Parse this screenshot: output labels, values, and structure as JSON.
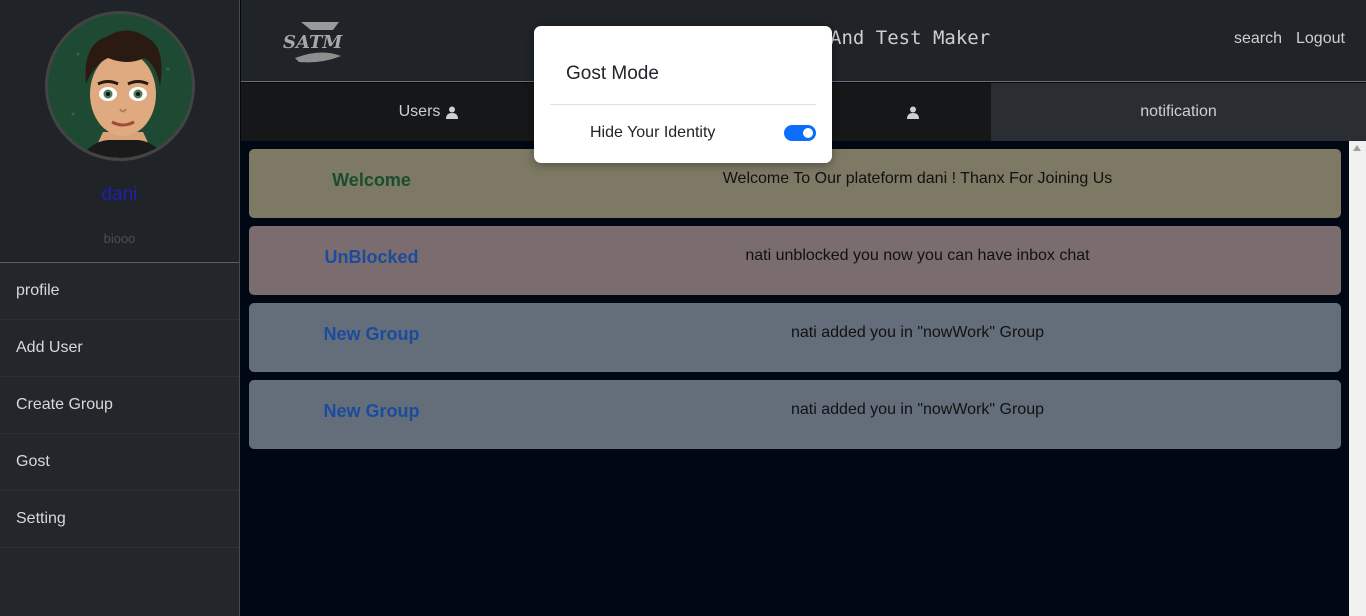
{
  "sidebar": {
    "username": "dani",
    "bio": "biooo",
    "items": [
      {
        "label": "profile"
      },
      {
        "label": "Add User"
      },
      {
        "label": "Create Group"
      },
      {
        "label": "Gost"
      },
      {
        "label": "Setting"
      }
    ]
  },
  "header": {
    "logo_text": "SATM",
    "title": "And Test Maker",
    "search_label": "search",
    "logout_label": "Logout"
  },
  "tabs": [
    {
      "label": "Users",
      "icon": "user-icon"
    },
    {
      "label": "",
      "icon": "user-icon"
    },
    {
      "label": "notification"
    }
  ],
  "notifications": [
    {
      "title": "Welcome",
      "message": "Welcome To Our plateform dani ! Thanx For Joining Us",
      "bg": "#7d7964",
      "title_color": "#1a4d2e"
    },
    {
      "title": "UnBlocked",
      "message": "nati unblocked you now you can have inbox chat",
      "bg": "#7b6c6f",
      "title_color": "#1b4b9c"
    },
    {
      "title": "New Group",
      "message": "nati added you in \"nowWork\" Group",
      "bg": "#646e7b",
      "title_color": "#1b4b9c"
    },
    {
      "title": "New Group",
      "message": "nati added you in \"nowWork\" Group",
      "bg": "#646e7b",
      "title_color": "#1b4b9c"
    }
  ],
  "modal": {
    "title": "Gost Mode",
    "toggle_label": "Hide Your Identity",
    "toggle_on": true,
    "toggle_color": "#0d6efd"
  }
}
